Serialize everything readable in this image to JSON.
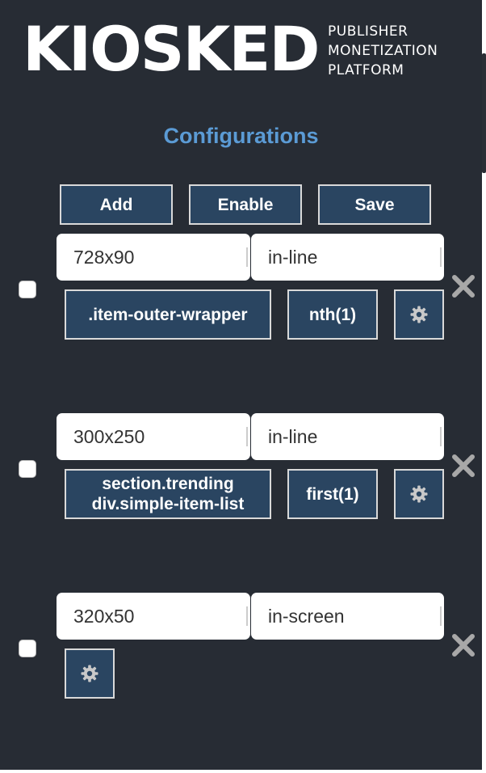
{
  "brand": {
    "logo": "KIOSKED",
    "tagline": [
      "PUBLISHER",
      "MONETIZATION",
      "PLATFORM"
    ]
  },
  "title": "Configurations",
  "toolbar": {
    "add_label": "Add",
    "enable_label": "Enable",
    "save_label": "Save"
  },
  "configs": [
    {
      "size": "728x90",
      "placement": "in-line",
      "selector": ".item-outer-wrapper",
      "position": "nth(1)"
    },
    {
      "size": "300x250",
      "placement": "in-line",
      "selector_line1": "section.trending",
      "selector_line2": "div.simple-item-list",
      "position": "first(1)"
    },
    {
      "size": "320x50",
      "placement": "in-screen"
    }
  ],
  "colors": {
    "background": "#272c34",
    "title": "#5b9bd5",
    "button": "#2a4561",
    "remove": "#a8a8a8"
  },
  "icons": [
    "gear-icon",
    "close-icon"
  ]
}
